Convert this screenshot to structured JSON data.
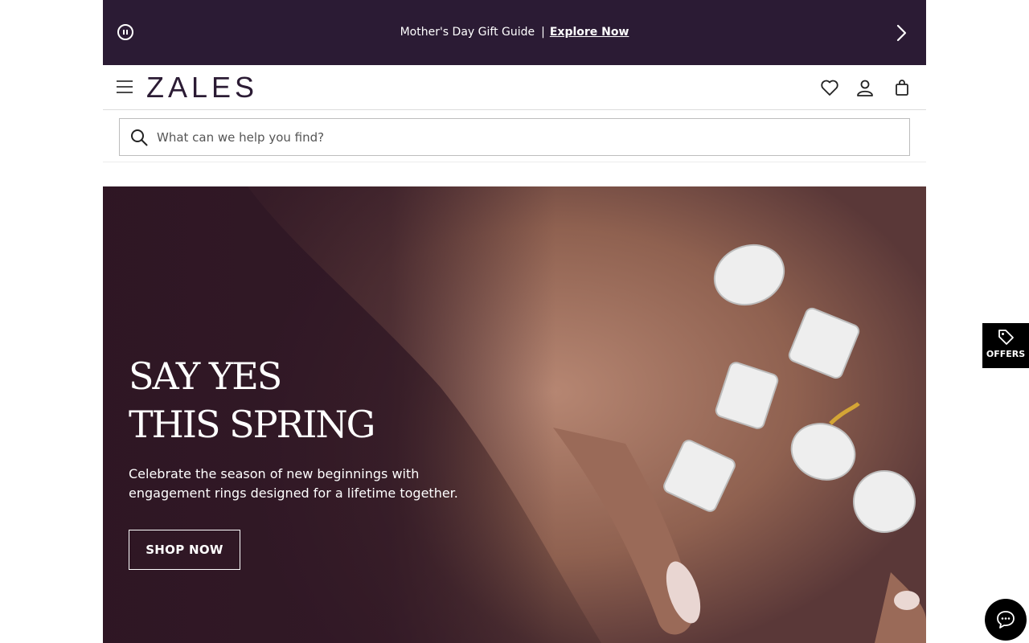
{
  "promo": {
    "text": "Mother's Day Gift Guide",
    "separator": "|",
    "link": "Explore Now",
    "pause_icon": "pause-circle-icon",
    "next_icon": "chevron-right-icon",
    "background": "#2b1b34"
  },
  "header": {
    "logo": "ZALES",
    "menu_icon": "hamburger-icon",
    "icons": [
      "heart-icon",
      "user-icon",
      "shopping-bag-icon"
    ],
    "brand_color": "#2b1b34"
  },
  "search": {
    "placeholder": "What can we help you find?",
    "value": "",
    "icon": "search-icon"
  },
  "hero": {
    "title_line1": "SAY YES",
    "title_line2": "THIS SPRING",
    "description": "Celebrate the season of new beginnings with engagement rings designed for a lifetime together.",
    "cta": "SHOP NOW"
  },
  "offers": {
    "label": "OFFERS",
    "icon": "tag-icon"
  },
  "chat": {
    "icon": "chat-bubble-icon"
  }
}
